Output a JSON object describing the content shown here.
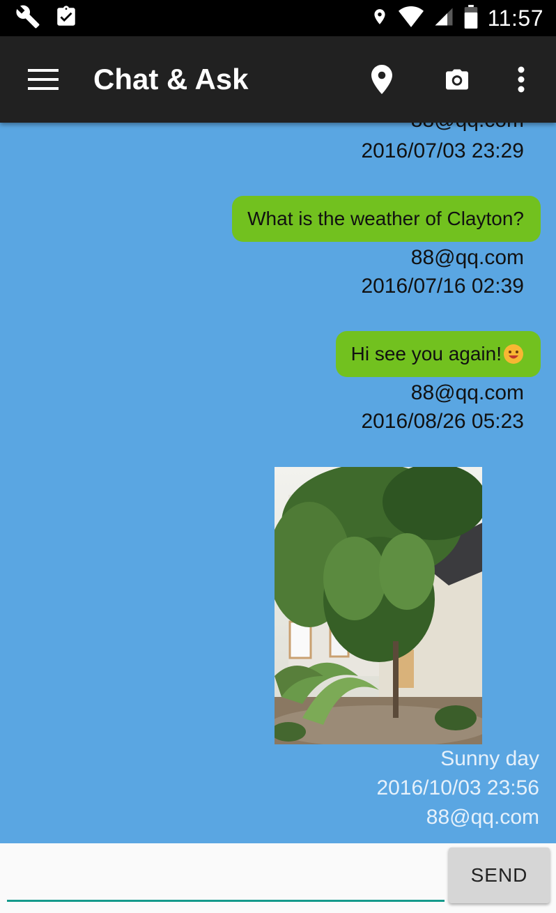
{
  "status_bar": {
    "time": "11:57",
    "left_icons": [
      "wrench-icon",
      "clipboard-check-icon"
    ],
    "right_icons": [
      "location-pin-icon",
      "wifi-icon",
      "cell-signal-icon",
      "battery-icon"
    ]
  },
  "app_bar": {
    "title": "Chat & Ask",
    "background": "#212121",
    "actions": [
      "menu-icon",
      "location-pin-icon",
      "camera-icon",
      "overflow-menu-icon"
    ]
  },
  "chat": {
    "background": "#5aa6e2",
    "bubble_color": "#72c11f",
    "partial_top": {
      "sender": "88@qq.com",
      "timestamp": "2016/07/03 23:29"
    },
    "messages": [
      {
        "text": "What is the weather of Clayton?",
        "sender": "88@qq.com",
        "timestamp": "2016/07/16 02:39"
      },
      {
        "text": "Hi see you again!",
        "emoji": "smiling-face-emoji",
        "sender": "88@qq.com",
        "timestamp": "2016/08/26 05:23"
      }
    ],
    "image_message": {
      "caption": "Sunny day",
      "timestamp": "2016/10/03 23:56",
      "sender": "88@qq.com"
    }
  },
  "input_bar": {
    "value": "",
    "placeholder": "",
    "send_label": "SEND",
    "accent": "#159a8c"
  }
}
